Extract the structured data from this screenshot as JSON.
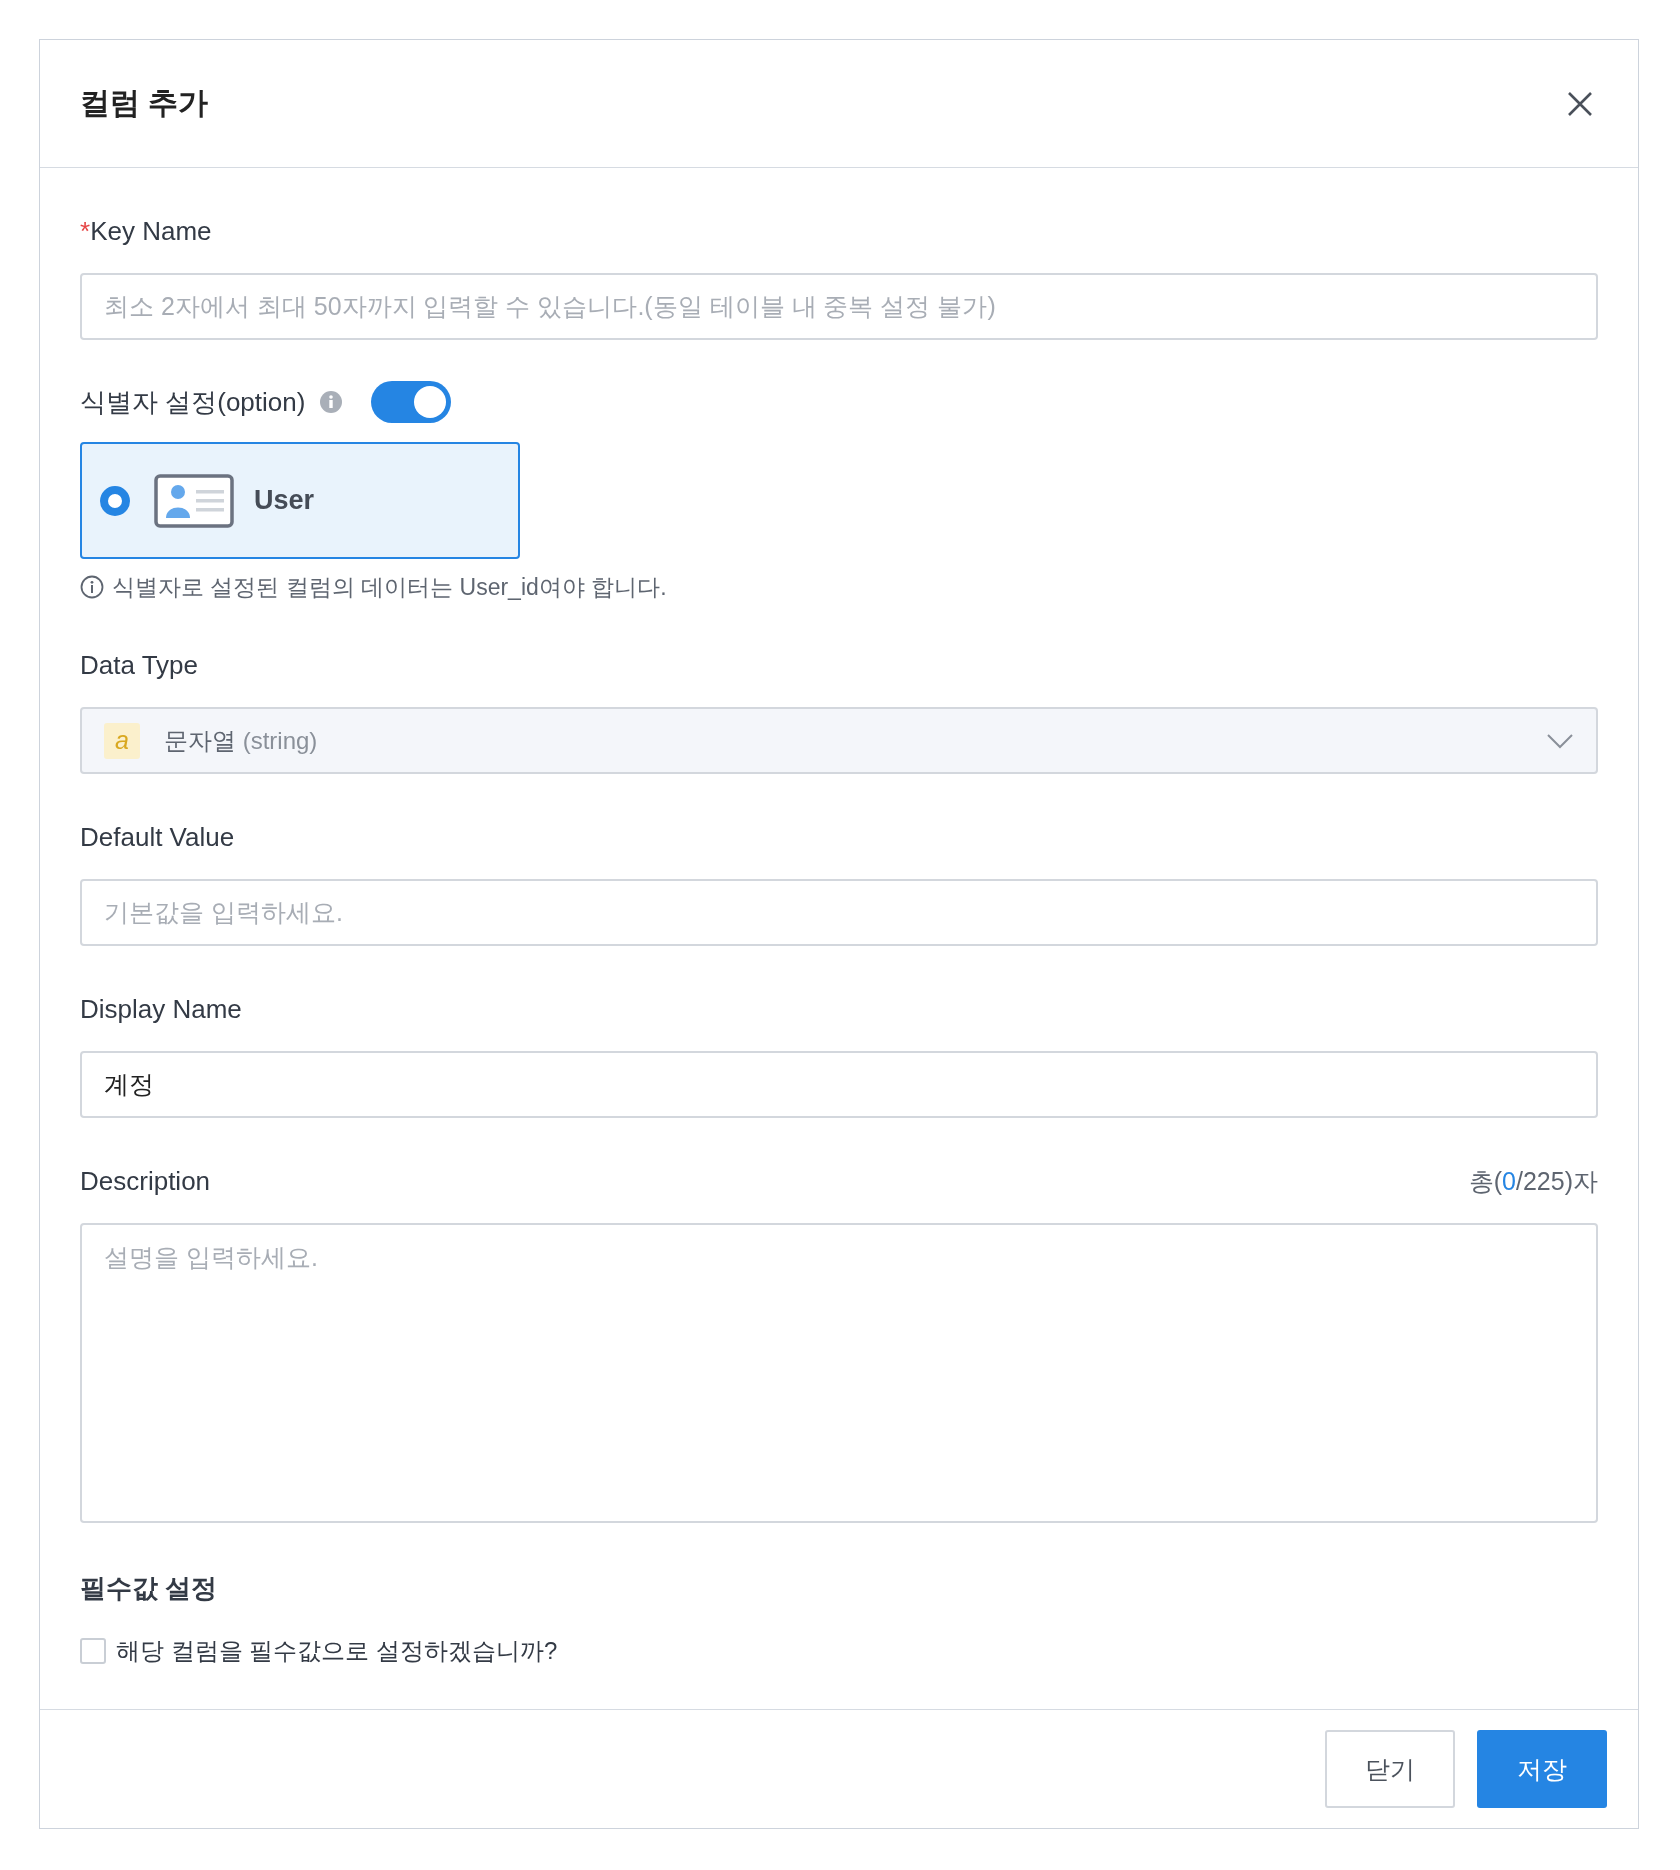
{
  "dialog": {
    "title": "컬럼 추가"
  },
  "key_name": {
    "required_mark": "*",
    "label": "Key Name",
    "placeholder": "최소 2자에서 최대 50자까지 입력할 수 있습니다.(동일 테이블 내 중복 설정 불가)"
  },
  "identifier": {
    "label": "식별자 설정(option)",
    "on": true,
    "options": [
      {
        "label": "User",
        "selected": true
      }
    ],
    "note": "식별자로 설정된 컬럼의 데이터는 User_id여야 합니다."
  },
  "data_type": {
    "label": "Data Type",
    "badge": "a",
    "value": "문자열",
    "hint": "(string)"
  },
  "default_value": {
    "label": "Default Value",
    "placeholder": "기본값을 입력하세요."
  },
  "display_name": {
    "label": "Display Name",
    "value": "계정"
  },
  "description": {
    "label": "Description",
    "counter_prefix": "총(",
    "counter_count": "0",
    "counter_suffix": "/225)자",
    "placeholder": "설명을 입력하세요."
  },
  "required": {
    "label": "필수값 설정",
    "checkbox_label": "해당 컬럼을 필수값으로 설정하겠습니까?",
    "checked": false
  },
  "buttons": [
    {
      "label": "닫기",
      "kind": "secondary"
    },
    {
      "label": "저장",
      "kind": "primary"
    }
  ]
}
